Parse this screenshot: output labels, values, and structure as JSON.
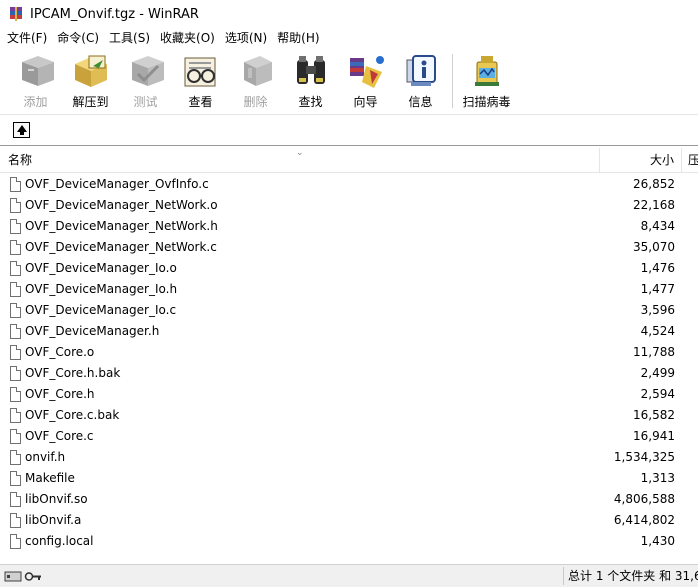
{
  "window": {
    "title": "IPCAM_Onvif.tgz - WinRAR"
  },
  "menu": [
    {
      "label": "文件(F)"
    },
    {
      "label": "命令(C)"
    },
    {
      "label": "工具(S)"
    },
    {
      "label": "收藏夹(O)"
    },
    {
      "label": "选项(N)"
    },
    {
      "label": "帮助(H)"
    }
  ],
  "toolbar": {
    "add": {
      "label": "添加",
      "icon": "add-icon",
      "enabled": false
    },
    "extract": {
      "label": "解压到",
      "icon": "extract-icon",
      "enabled": true
    },
    "test": {
      "label": "测试",
      "icon": "test-icon",
      "enabled": false
    },
    "view": {
      "label": "查看",
      "icon": "view-icon",
      "enabled": true
    },
    "delete": {
      "label": "删除",
      "icon": "delete-icon",
      "enabled": false
    },
    "find": {
      "label": "查找",
      "icon": "find-icon",
      "enabled": true
    },
    "wizard": {
      "label": "向导",
      "icon": "wizard-icon",
      "enabled": true
    },
    "info": {
      "label": "信息",
      "icon": "info-icon",
      "enabled": true
    },
    "virus": {
      "label": "扫描病毒",
      "icon": "virus-scan-icon",
      "enabled": true
    }
  },
  "list": {
    "columns": {
      "name": "名称",
      "size": "大小",
      "packed": "压"
    },
    "files": [
      {
        "name": "OVF_DeviceManager_OvfInfo.c",
        "size": "26,852"
      },
      {
        "name": "OVF_DeviceManager_NetWork.o",
        "size": "22,168"
      },
      {
        "name": "OVF_DeviceManager_NetWork.h",
        "size": "8,434"
      },
      {
        "name": "OVF_DeviceManager_NetWork.c",
        "size": "35,070"
      },
      {
        "name": "OVF_DeviceManager_Io.o",
        "size": "1,476"
      },
      {
        "name": "OVF_DeviceManager_Io.h",
        "size": "1,477"
      },
      {
        "name": "OVF_DeviceManager_Io.c",
        "size": "3,596"
      },
      {
        "name": "OVF_DeviceManager.h",
        "size": "4,524"
      },
      {
        "name": "OVF_Core.o",
        "size": "11,788"
      },
      {
        "name": "OVF_Core.h.bak",
        "size": "2,499"
      },
      {
        "name": "OVF_Core.h",
        "size": "2,594"
      },
      {
        "name": "OVF_Core.c.bak",
        "size": "16,582"
      },
      {
        "name": "OVF_Core.c",
        "size": "16,941"
      },
      {
        "name": "onvif.h",
        "size": "1,534,325"
      },
      {
        "name": "Makefile",
        "size": "1,313"
      },
      {
        "name": "libOnvif.so",
        "size": "4,806,588"
      },
      {
        "name": "libOnvif.a",
        "size": "6,414,802"
      },
      {
        "name": "config.local",
        "size": "1,430"
      }
    ]
  },
  "status": {
    "text": "总计 1 个文件夹 和 31,6"
  }
}
